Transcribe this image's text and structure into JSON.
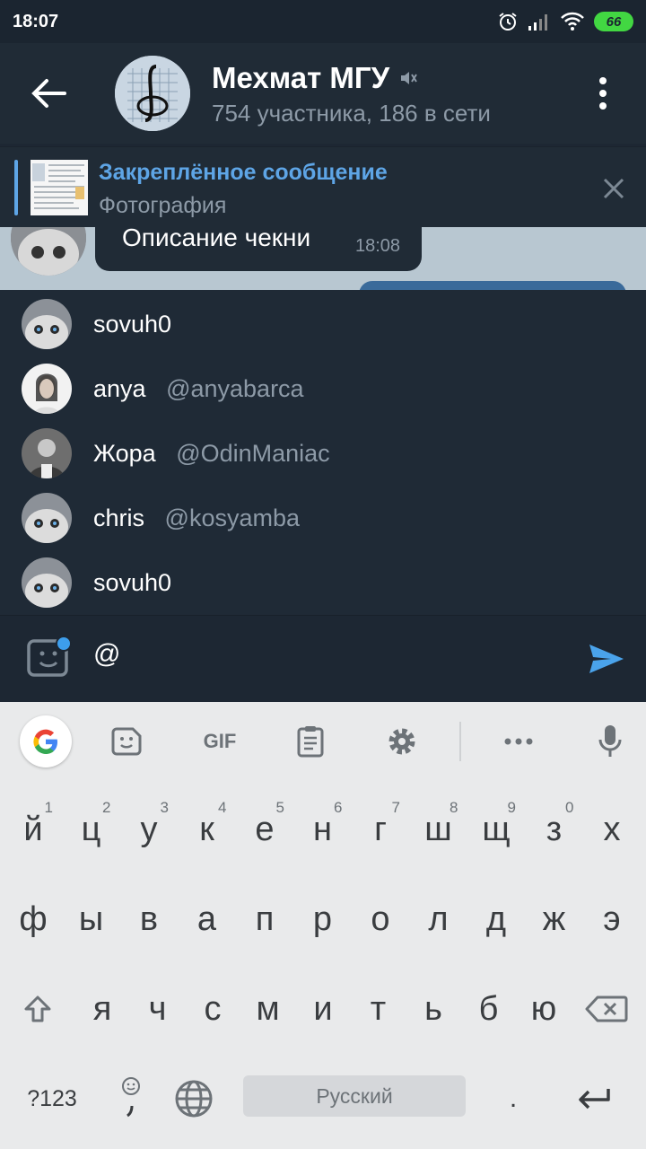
{
  "status": {
    "time": "18:07",
    "battery": "66"
  },
  "header": {
    "title": "Мехмат МГУ",
    "subtitle": "754 участника, 186 в сети"
  },
  "pinned": {
    "title": "Закреплённое сообщение",
    "text": "Фотография"
  },
  "chat": {
    "message_text": "Описание чекни",
    "message_time": "18:08"
  },
  "mentions": [
    {
      "name": "sovuh0",
      "handle": ""
    },
    {
      "name": "anya",
      "handle": "@anyabarca"
    },
    {
      "name": "Жора",
      "handle": "@OdinManiac"
    },
    {
      "name": "chris",
      "handle": "@kosyamba"
    },
    {
      "name": "sovuh0",
      "handle": ""
    }
  ],
  "input": {
    "value": "@"
  },
  "keyboard": {
    "toolbar": {
      "gif": "GIF"
    },
    "row1": [
      {
        "k": "й",
        "n": "1"
      },
      {
        "k": "ц",
        "n": "2"
      },
      {
        "k": "у",
        "n": "3"
      },
      {
        "k": "к",
        "n": "4"
      },
      {
        "k": "е",
        "n": "5"
      },
      {
        "k": "н",
        "n": "6"
      },
      {
        "k": "г",
        "n": "7"
      },
      {
        "k": "ш",
        "n": "8"
      },
      {
        "k": "щ",
        "n": "9"
      },
      {
        "k": "з",
        "n": "0"
      },
      {
        "k": "х",
        "n": ""
      }
    ],
    "row2": [
      "ф",
      "ы",
      "в",
      "а",
      "п",
      "р",
      "о",
      "л",
      "д",
      "ж",
      "э"
    ],
    "row3": [
      "я",
      "ч",
      "с",
      "м",
      "и",
      "т",
      "ь",
      "б",
      "ю"
    ],
    "row4": {
      "symbols": "?123",
      "space": "Русский",
      "period": "."
    }
  },
  "colors": {
    "accent": "#5ea5e6",
    "background": "#1d2733",
    "keyboard": "#e9eaeb"
  }
}
